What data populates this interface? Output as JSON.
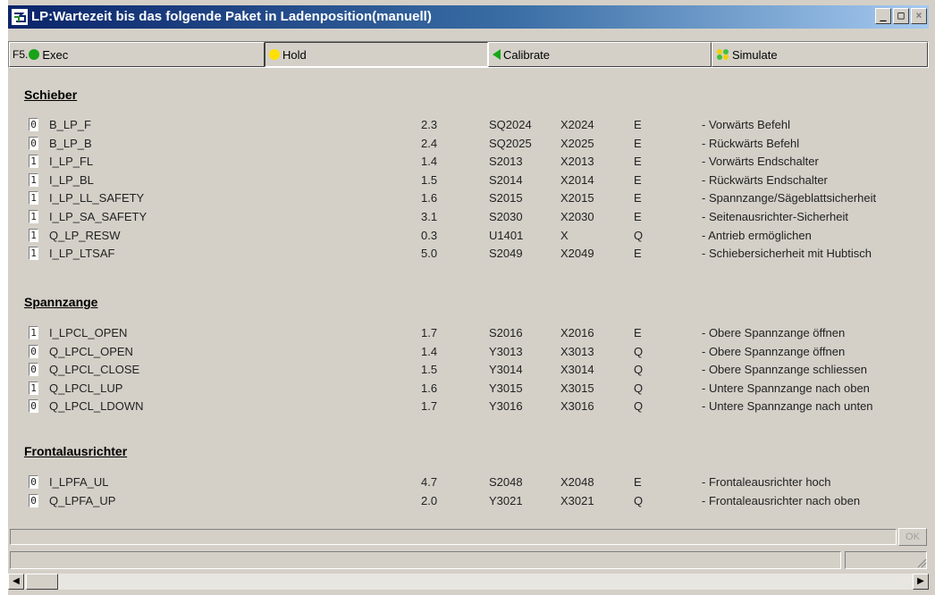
{
  "window": {
    "title": "LP:Wartezeit bis das folgende Paket in Ladenposition(manuell)",
    "min_glyph": "_",
    "max_glyph": "□",
    "close_glyph": "×"
  },
  "toolbar": {
    "f5_label": "F5.",
    "exec_label": "Exec",
    "hold_label": "Hold",
    "calibrate_label": "Calibrate",
    "simulate_label": "Simulate",
    "exec_color": "#1aa11a",
    "hold_color": "#ffe000",
    "calibrate_color": "#16a816"
  },
  "sections": [
    {
      "title": "Schieber",
      "rows": [
        {
          "value": "0",
          "name": "B_LP_F",
          "num": "2.3",
          "sensor": "SQ2024",
          "address": "X2024",
          "type": "E",
          "desc": "- Vorwärts Befehl"
        },
        {
          "value": "0",
          "name": "B_LP_B",
          "num": "2.4",
          "sensor": "SQ2025",
          "address": "X2025",
          "type": "E",
          "desc": "- Rückwärts Befehl"
        },
        {
          "value": "1",
          "name": "I_LP_FL",
          "num": "1.4",
          "sensor": "S2013",
          "address": "X2013",
          "type": "E",
          "desc": "- Vorwärts Endschalter"
        },
        {
          "value": "1",
          "name": "I_LP_BL",
          "num": "1.5",
          "sensor": "S2014",
          "address": "X2014",
          "type": "E",
          "desc": "- Rückwärts Endschalter"
        },
        {
          "value": "1",
          "name": "I_LP_LL_SAFETY",
          "num": "1.6",
          "sensor": "S2015",
          "address": "X2015",
          "type": "E",
          "desc": "- Spannzange/Sägeblattsicherheit"
        },
        {
          "value": "1",
          "name": "I_LP_SA_SAFETY",
          "num": "3.1",
          "sensor": "S2030",
          "address": "X2030",
          "type": "E",
          "desc": "- Seitenausrichter-Sicherheit"
        },
        {
          "value": "1",
          "name": "Q_LP_RESW",
          "num": "0.3",
          "sensor": "U1401",
          "address": "X",
          "type": "Q",
          "desc": "- Antrieb ermöglichen"
        },
        {
          "value": "1",
          "name": "I_LP_LTSAF",
          "num": "5.0",
          "sensor": "S2049",
          "address": "X2049",
          "type": "E",
          "desc": "- Schiebersicherheit mit Hubtisch"
        }
      ]
    },
    {
      "title": "Spannzange",
      "rows": [
        {
          "value": "1",
          "name": "I_LPCL_OPEN",
          "num": "1.7",
          "sensor": "S2016",
          "address": "X2016",
          "type": "E",
          "desc": "- Obere Spannzange öffnen"
        },
        {
          "value": "0",
          "name": "Q_LPCL_OPEN",
          "num": "1.4",
          "sensor": "Y3013",
          "address": "X3013",
          "type": "Q",
          "desc": "- Obere Spannzange öffnen"
        },
        {
          "value": "0",
          "name": "Q_LPCL_CLOSE",
          "num": "1.5",
          "sensor": "Y3014",
          "address": "X3014",
          "type": "Q",
          "desc": "- Obere Spannzange schliessen"
        },
        {
          "value": "1",
          "name": "Q_LPCL_LUP",
          "num": "1.6",
          "sensor": "Y3015",
          "address": "X3015",
          "type": "Q",
          "desc": "- Untere Spannzange nach oben"
        },
        {
          "value": "0",
          "name": "Q_LPCL_LDOWN",
          "num": "1.7",
          "sensor": "Y3016",
          "address": "X3016",
          "type": "Q",
          "desc": "- Untere Spannzange nach unten"
        }
      ]
    },
    {
      "title": "Frontalausrichter",
      "rows": [
        {
          "value": "0",
          "name": "I_LPFA_UL",
          "num": "4.7",
          "sensor": "S2048",
          "address": "X2048",
          "type": "E",
          "desc": "- Frontaleausrichter hoch"
        },
        {
          "value": "0",
          "name": "Q_LPFA_UP",
          "num": "2.0",
          "sensor": "Y3021",
          "address": "X3021",
          "type": "Q",
          "desc": "- Frontaleausrichter nach oben"
        }
      ]
    }
  ],
  "footer": {
    "ok_label": "OK"
  }
}
